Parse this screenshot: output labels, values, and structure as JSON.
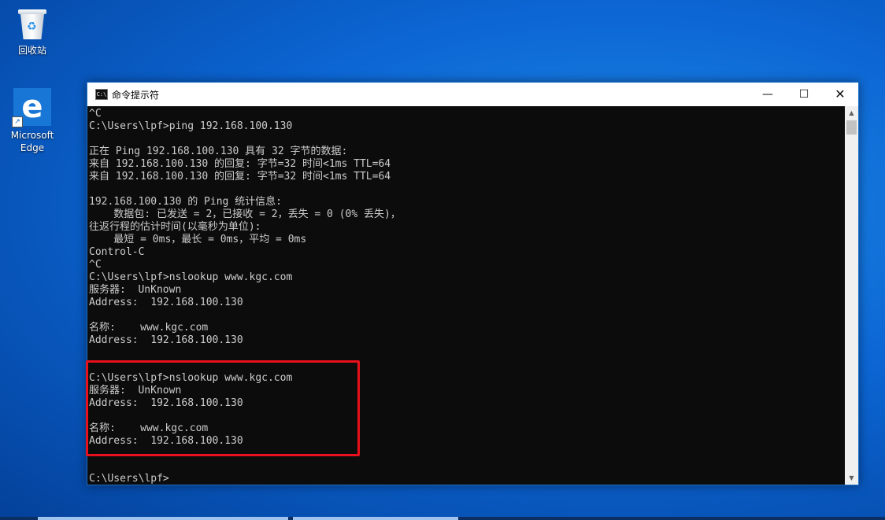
{
  "desktop": {
    "icons": [
      {
        "label": "回收站",
        "icon": "recycle-bin-icon"
      },
      {
        "label": "Microsoft Edge",
        "icon": "edge-icon"
      }
    ],
    "background_color": "#0c66d4"
  },
  "window": {
    "title": "命令提示符",
    "app_icon_text": "C:\\",
    "minimize_glyph": "—",
    "maximize_glyph": "☐",
    "close_glyph": "✕"
  },
  "terminal": {
    "lines": [
      "^C",
      "C:\\Users\\lpf>ping 192.168.100.130",
      "",
      "正在 Ping 192.168.100.130 具有 32 字节的数据:",
      "来自 192.168.100.130 的回复: 字节=32 时间<1ms TTL=64",
      "来自 192.168.100.130 的回复: 字节=32 时间<1ms TTL=64",
      "",
      "192.168.100.130 的 Ping 统计信息:",
      "    数据包: 已发送 = 2，已接收 = 2，丢失 = 0 (0% 丢失)，",
      "往返行程的估计时间(以毫秒为单位):",
      "    最短 = 0ms，最长 = 0ms，平均 = 0ms",
      "Control-C",
      "^C",
      "C:\\Users\\lpf>nslookup www.kgc.com",
      "服务器:  UnKnown",
      "Address:  192.168.100.130",
      "",
      "名称:    www.kgc.com",
      "Address:  192.168.100.130",
      "",
      "",
      "C:\\Users\\lpf>nslookup www.kgc.com",
      "服务器:  UnKnown",
      "Address:  192.168.100.130",
      "",
      "名称:    www.kgc.com",
      "Address:  192.168.100.130",
      "",
      "",
      "C:\\Users\\lpf>"
    ],
    "text_color": "#cccccc",
    "background_color": "#0c0c0c",
    "highlight_color": "#e8101a"
  }
}
